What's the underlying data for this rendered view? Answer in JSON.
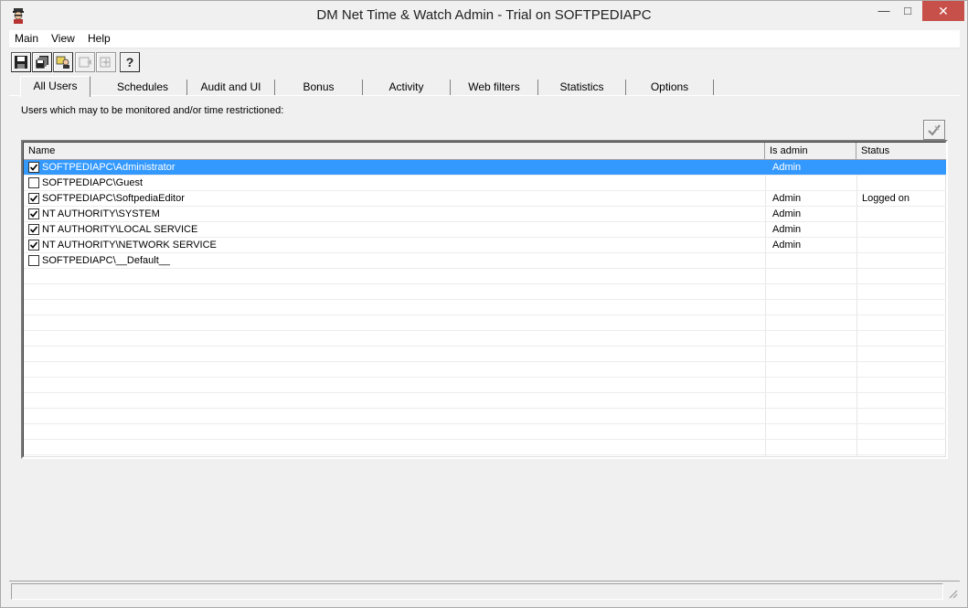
{
  "window": {
    "title": "DM Net Time & Watch Admin - Trial on SOFTPEDIAPC",
    "minimize": "—",
    "maximize": "□",
    "close": "✕"
  },
  "menu": {
    "items": [
      "Main",
      "View",
      "Help"
    ]
  },
  "toolbar": {
    "help_label": "?",
    "icons": [
      "save-icon",
      "copy-all-icon",
      "users-icon",
      "disabled-tool-icon",
      "disabled-tool-icon",
      "help-icon"
    ]
  },
  "tabs": [
    "All Users",
    "Schedules",
    "Audit and UI",
    "Bonus",
    "Activity",
    "Web filters",
    "Statistics",
    "Options"
  ],
  "active_tab": "All Users",
  "users_panel": {
    "hint": "Users which may to be monitored and/or time restrictioned:",
    "columns": [
      "Name",
      "Is admin",
      "Status"
    ],
    "rows": [
      {
        "checked": true,
        "name": "SOFTPEDIAPC\\Administrator",
        "admin": "Admin",
        "status": "",
        "selected": true
      },
      {
        "checked": false,
        "name": "SOFTPEDIAPC\\Guest",
        "admin": "",
        "status": "",
        "selected": false
      },
      {
        "checked": true,
        "name": "SOFTPEDIAPC\\SoftpediaEditor",
        "admin": "Admin",
        "status": "Logged on",
        "selected": false
      },
      {
        "checked": true,
        "name": "NT AUTHORITY\\SYSTEM",
        "admin": "Admin",
        "status": "",
        "selected": false
      },
      {
        "checked": true,
        "name": "NT AUTHORITY\\LOCAL SERVICE",
        "admin": "Admin",
        "status": "",
        "selected": false
      },
      {
        "checked": true,
        "name": "NT AUTHORITY\\NETWORK SERVICE",
        "admin": "Admin",
        "status": "",
        "selected": false
      },
      {
        "checked": false,
        "name": "SOFTPEDIAPC\\__Default__",
        "admin": "",
        "status": "",
        "selected": false
      }
    ]
  },
  "colors": {
    "selection": "#3399ff",
    "close_button": "#c7504a",
    "window_bg": "#f0f0f0"
  },
  "statusbar": {
    "text": ""
  }
}
